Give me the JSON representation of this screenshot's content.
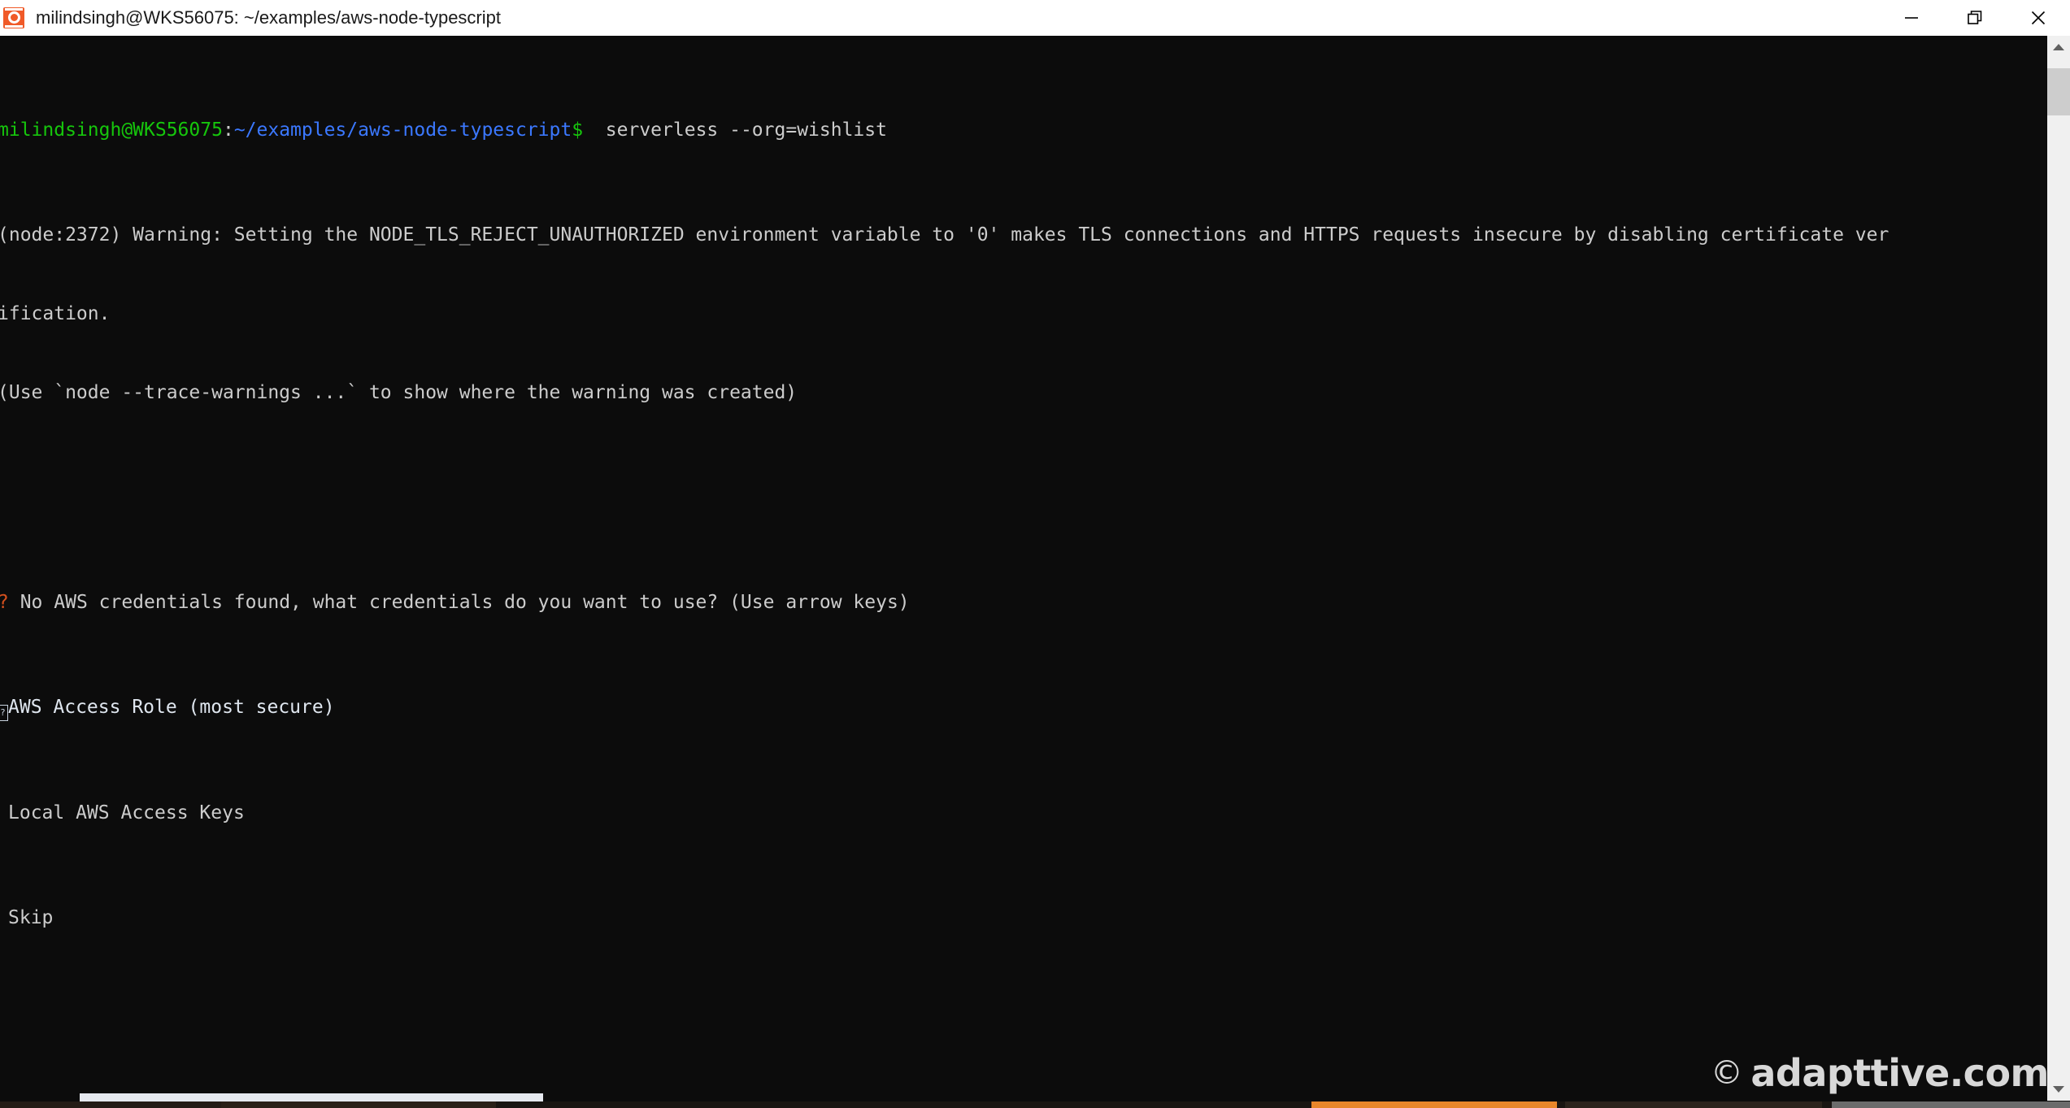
{
  "window": {
    "title": "milindsingh@WKS56075: ~/examples/aws-node-typescript",
    "icon": "cmder-terminal-icon",
    "controls": {
      "minimize": "minimize-icon",
      "restore": "restore-icon",
      "close": "close-icon"
    },
    "titlebar_bg": "#ffffff",
    "titlebar_fg": "#1a1a1a"
  },
  "terminal": {
    "background": "#0c0c0c",
    "foreground": "#cccccc",
    "colors": {
      "green": "#16c60c",
      "blue": "#3b78ff",
      "orange": "#d4501e",
      "white": "#cccccc"
    },
    "prompt": {
      "user_host": "milindsingh@WKS56075",
      "separator": ":",
      "path": "~/examples/aws-node-typescript",
      "sigil": "$",
      "command": "  serverless --org=wishlist"
    },
    "output_lines": [
      "(node:2372) Warning: Setting the NODE_TLS_REJECT_UNAUTHORIZED environment variable to '0' makes TLS connections and HTTPS requests insecure by disabling certificate ver",
      "ification.",
      "(Use `node --trace-warnings ...` to show where the warning was created)"
    ],
    "question": {
      "marker": "?",
      "text": " No AWS credentials found, what credentials do you want to use? (Use arrow keys)"
    },
    "choices": [
      {
        "label": "AWS Access Role (most secure)",
        "selected": true,
        "marker": "selection-pointer-tofu"
      },
      {
        "label": "Local AWS Access Keys",
        "selected": false,
        "marker": ""
      },
      {
        "label": "Skip",
        "selected": false,
        "marker": ""
      }
    ]
  },
  "scrollbars": {
    "vertical": {
      "up_arrow": "chevron-up-icon",
      "down_arrow": "chevron-down-icon"
    },
    "horizontal": {
      "present": true
    }
  },
  "watermark": {
    "symbol": "©",
    "text": "adapttive.com"
  }
}
